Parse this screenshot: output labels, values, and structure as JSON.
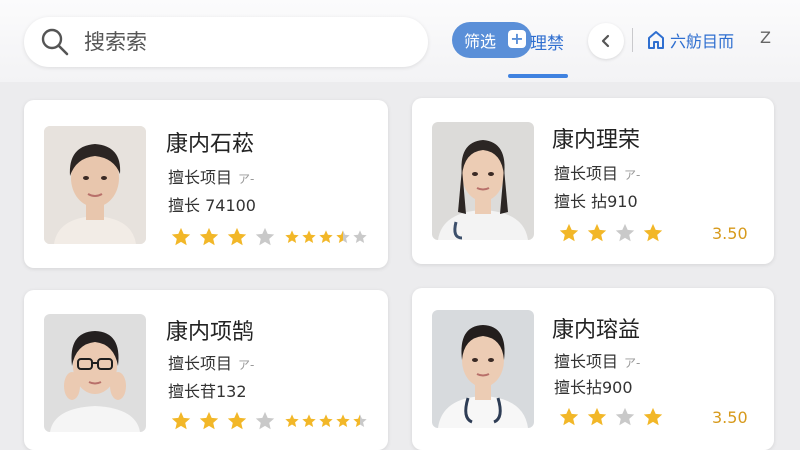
{
  "search": {
    "placeholder": "搜索索"
  },
  "toolbar": {
    "filter_label": "筛选",
    "manage_label": "理禁",
    "home_label": "六舫目而",
    "z_label": "Z"
  },
  "cards": [
    {
      "name": "康内石菘",
      "specialty_label": "擅长项目",
      "specialty_extra": "ア-",
      "price": "擅长 ‍74100",
      "stars": [
        1,
        1,
        1,
        0
      ],
      "mini_stars": [
        1,
        1,
        1,
        0.5,
        0
      ],
      "rating": "",
      "colors": {
        "shirt": "#f2ece6",
        "hair": "#2b2523",
        "skin": "#e8c6ad"
      }
    },
    {
      "name": "康内理荣",
      "specialty_label": "擅长项目",
      "specialty_extra": "ア-",
      "price": "擅长 拈910",
      "stars": [
        1,
        1,
        0,
        1
      ],
      "mini_stars": [],
      "rating": "3.50",
      "colors": {
        "shirt": "#f3f3f3",
        "hair": "#2c2624",
        "skin": "#ecccb4"
      }
    },
    {
      "name": "康内项鹄",
      "specialty_label": "擅长项目",
      "specialty_extra": "ア-",
      "price": "擅长苷132",
      "stars": [
        1,
        1,
        1,
        0
      ],
      "mini_stars": [
        1,
        1,
        1,
        1,
        0.5
      ],
      "rating": "",
      "colors": {
        "shirt": "#f5f5f5",
        "hair": "#242020",
        "skin": "#ebcab2"
      }
    },
    {
      "name": "康内瑢益",
      "specialty_label": "擅长项目",
      "specialty_extra": "ア-",
      "price": "擅长拈900",
      "stars": [
        1,
        1,
        0,
        1
      ],
      "mini_stars": [],
      "rating": "3.50",
      "colors": {
        "shirt": "#f7f7f7",
        "hair": "#231e1d",
        "skin": "#ecccb4"
      }
    }
  ],
  "colors": {
    "accent": "#5a8fd8",
    "star_on": "#f2b728",
    "star_off": "#c9c9c9",
    "rating": "#d79a1c"
  },
  "icons": [
    "search-icon",
    "plus-icon",
    "chevron-left-icon",
    "home-icon",
    "star-icon"
  ]
}
